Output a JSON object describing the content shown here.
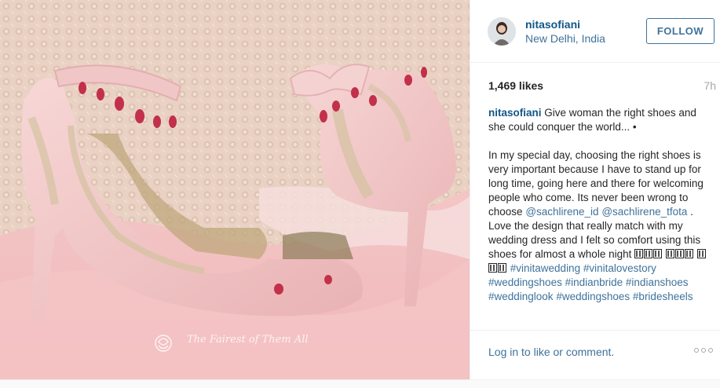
{
  "header": {
    "username": "nitasofiani",
    "location": "New Delhi, India",
    "follow_label": "FOLLOW"
  },
  "stats": {
    "likes": "1,469 likes",
    "time": "7h"
  },
  "caption": {
    "username": "nitasofiani",
    "line1": "Give woman the right shoes and she could conquer the world... •",
    "line2a": "In my special day, choosing the right shoes is very important because I have to stand up for long time, going here and there for welcoming people who come. Its never been wrong to choose",
    "mention1": "@sachlirene_id",
    "mention2": "@sachlirene_tfota",
    "line2b": ". Love the design that really match with my wedding dress and I felt so comfort using this shoes for almost a whole night",
    "hashtags": [
      "#vinitawedding",
      "#vinitalovestory",
      "#weddingshoes",
      "#indianbride",
      "#indianshoes",
      "#weddinglook",
      "#weddingshoes",
      "#bridesheels"
    ]
  },
  "footer": {
    "login_text": "Log in to like or comment."
  },
  "watermark": {
    "text": "The Fairest of Them All"
  },
  "icons": {
    "avatar": "profile-avatar",
    "more": "more-options-icon"
  },
  "colors": {
    "username": "#125688",
    "link": "#3f729b",
    "muted": "#a5a7aa"
  }
}
